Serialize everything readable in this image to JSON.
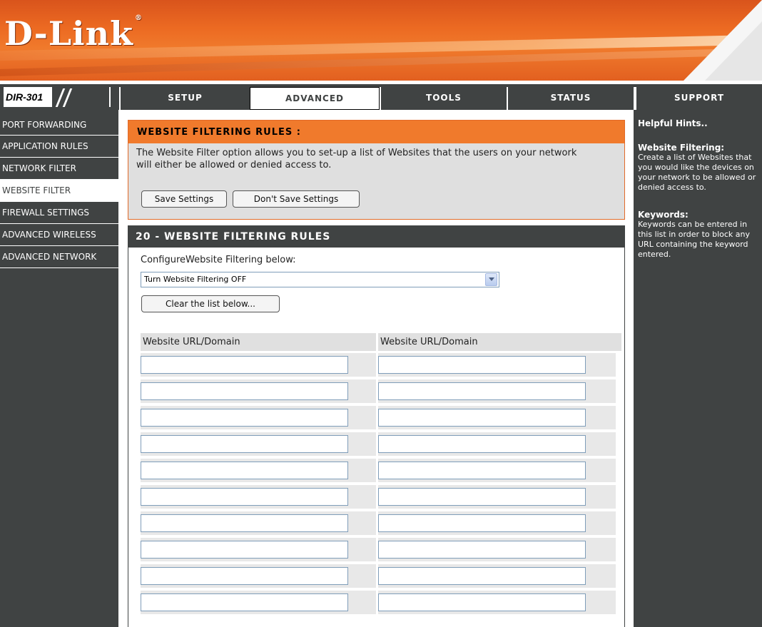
{
  "brand": {
    "logo": "D-Link",
    "model": "DIR-301"
  },
  "tabs": [
    {
      "label": "SETUP"
    },
    {
      "label": "ADVANCED"
    },
    {
      "label": "TOOLS"
    },
    {
      "label": "STATUS"
    },
    {
      "label": "SUPPORT"
    }
  ],
  "sidebar": {
    "items": [
      {
        "label": "PORT FORWARDING"
      },
      {
        "label": "APPLICATION RULES"
      },
      {
        "label": "NETWORK FILTER"
      },
      {
        "label": "WEBSITE FILTER"
      },
      {
        "label": "FIREWALL SETTINGS"
      },
      {
        "label": "ADVANCED WIRELESS"
      },
      {
        "label": "ADVANCED NETWORK"
      }
    ]
  },
  "rules_box": {
    "title": "WEBSITE FILTERING RULES :",
    "description": "The Website Filter option allows you to set-up a list of Websites that the users on your network will either be allowed or denied access to.",
    "save_label": "Save Settings",
    "dont_save_label": "Don't Save Settings"
  },
  "list_box": {
    "title": "20 - WEBSITE FILTERING RULES",
    "configure_label": "ConfigureWebsite Filtering below:",
    "select_value": "Turn Website Filtering OFF",
    "clear_label": "Clear the list below...",
    "col1_header": "Website URL/Domain",
    "col2_header": "Website URL/Domain",
    "rows": 10
  },
  "hints": {
    "title": "Helpful Hints..",
    "filtering_head": "Website Filtering:",
    "filtering_text": "Create a list of Websites that you would like the devices on your network to be allowed or denied access to.",
    "keywords_head": "Keywords:",
    "keywords_text": "Keywords can be entered in this list in order to block any URL containing the keyword entered."
  }
}
